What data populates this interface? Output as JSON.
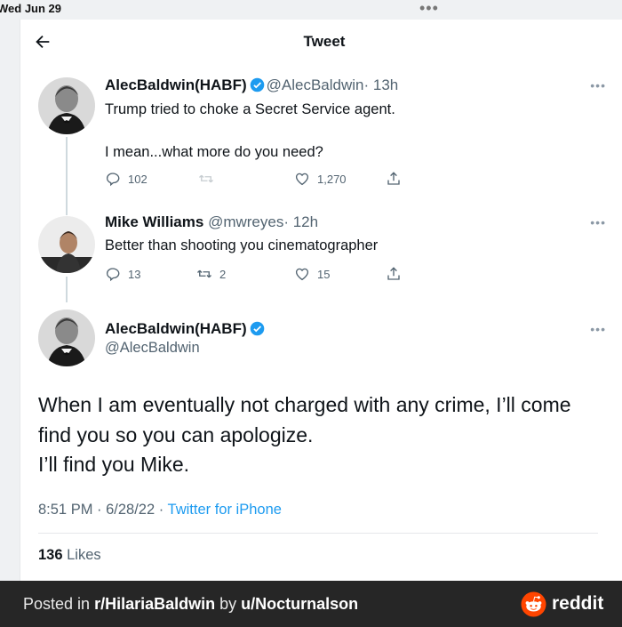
{
  "status_bar": {
    "date": "Wed Jun 29",
    "dots": "•••"
  },
  "header": {
    "title": "Tweet"
  },
  "tweets": [
    {
      "name": "AlecBaldwin(HABF)",
      "handle": "@AlecBaldwin",
      "time": "· 13h",
      "lines": [
        "Trump tried to choke a Secret Service agent.",
        "I mean...what more do you need?"
      ],
      "replies": "102",
      "retweets": "",
      "likes": "1,270"
    },
    {
      "name": "Mike Williams",
      "handle": "@mwreyes",
      "time": "· 12h",
      "lines": [
        "Better than shooting you cinematographer"
      ],
      "replies": "13",
      "retweets": "2",
      "likes": "15"
    }
  ],
  "main_tweet": {
    "name": "AlecBaldwin(HABF)",
    "handle": "@AlecBaldwin",
    "lines": [
      "When I am eventually not charged with any crime, I’ll come",
      "find you so you can apologize.",
      "I’ll find you Mike."
    ],
    "time": "8:51 PM · 6/28/22 · ",
    "source": "Twitter for iPhone",
    "likes_count": "136",
    "likes_label": "Likes"
  },
  "banner": {
    "prefix": "Posted in ",
    "subreddit": "r/HilariaBaldwin",
    "middle": " by ",
    "user": "u/Nocturnalson",
    "brand": "reddit"
  },
  "colors": {
    "accent": "#1d9bf0",
    "reddit_orange": "#ff4500",
    "banner_bg": "#262626"
  },
  "icons": [
    "back-arrow-icon",
    "verified-icon",
    "reply-icon",
    "retweet-icon",
    "like-icon",
    "share-icon",
    "more-icon",
    "reddit-logo-icon"
  ]
}
